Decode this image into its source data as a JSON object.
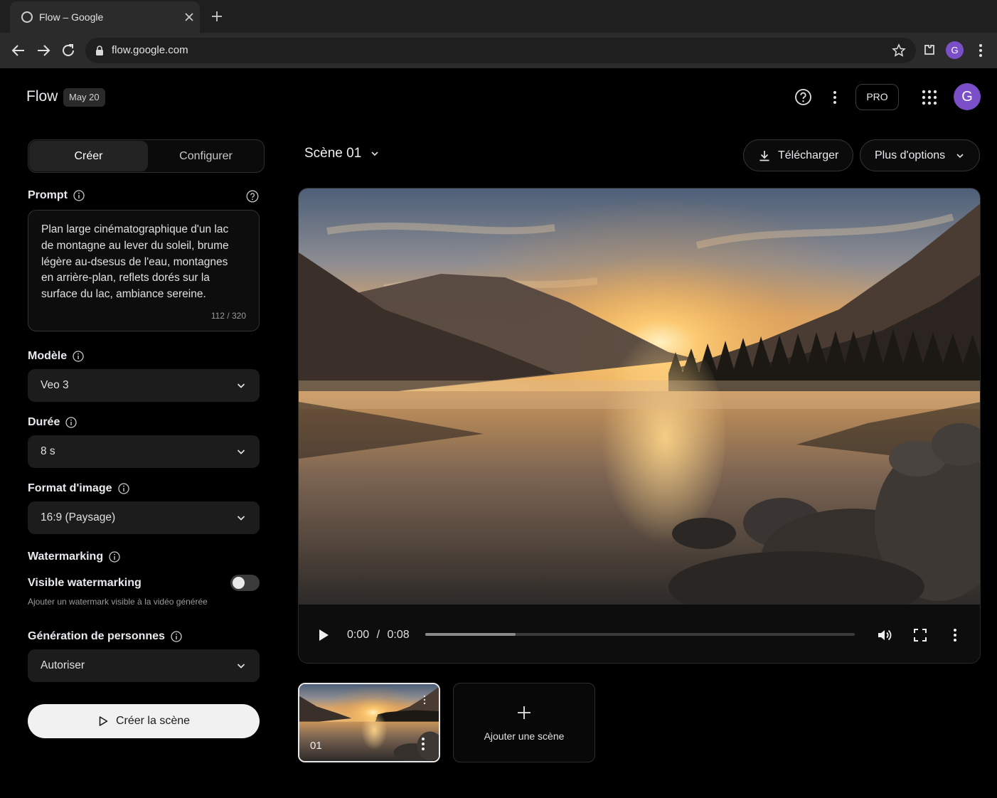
{
  "browser": {
    "tab_title": "Flow – Google",
    "url": "flow.google.com",
    "profile_initial": "G"
  },
  "header": {
    "title": "Flow",
    "date_badge": "May 20",
    "pro_label": "PRO",
    "avatar_initial": "G"
  },
  "panel": {
    "tabs": [
      {
        "label": "Créer",
        "active": true
      },
      {
        "label": "Configurer",
        "active": false
      }
    ],
    "prompt": {
      "label": "Prompt",
      "text": "Plan large cinématographique d'un lac de montagne au lever du soleil, brume légère au-dsesus de l'eau, montagnes en arrière-plan, reflets dorés sur la surface du lac, ambiance sereine.",
      "count": "112 / 320"
    },
    "model": {
      "label": "Modèle",
      "value": "Veo 3"
    },
    "duration": {
      "label": "Durée",
      "value": "8 s"
    },
    "format": {
      "label": "Format d'image",
      "value": "16:9 (Paysage)"
    },
    "watermarking": {
      "label": "Watermarking",
      "option_title": "Visible watermarking",
      "option_desc": "Ajouter un watermark visible à la vidéo générée",
      "enabled": false
    },
    "people": {
      "label": "Génération de personnes",
      "value": "Autoriser"
    },
    "create_button": "Créer la scène"
  },
  "main": {
    "scene_title": "Scène 01",
    "download_label": "Télécharger",
    "more_options_label": "Plus d'options",
    "player": {
      "current": "0:00",
      "separator": "/",
      "duration": "0:08",
      "progress_fraction": 0.21
    },
    "scenes": [
      {
        "label": "01",
        "selected": true
      }
    ],
    "add_scene_label": "Ajouter une scène"
  },
  "colors": {
    "background": "#000000",
    "avatar": "#7b4fc7",
    "primary_button": "#f1f1f1"
  }
}
